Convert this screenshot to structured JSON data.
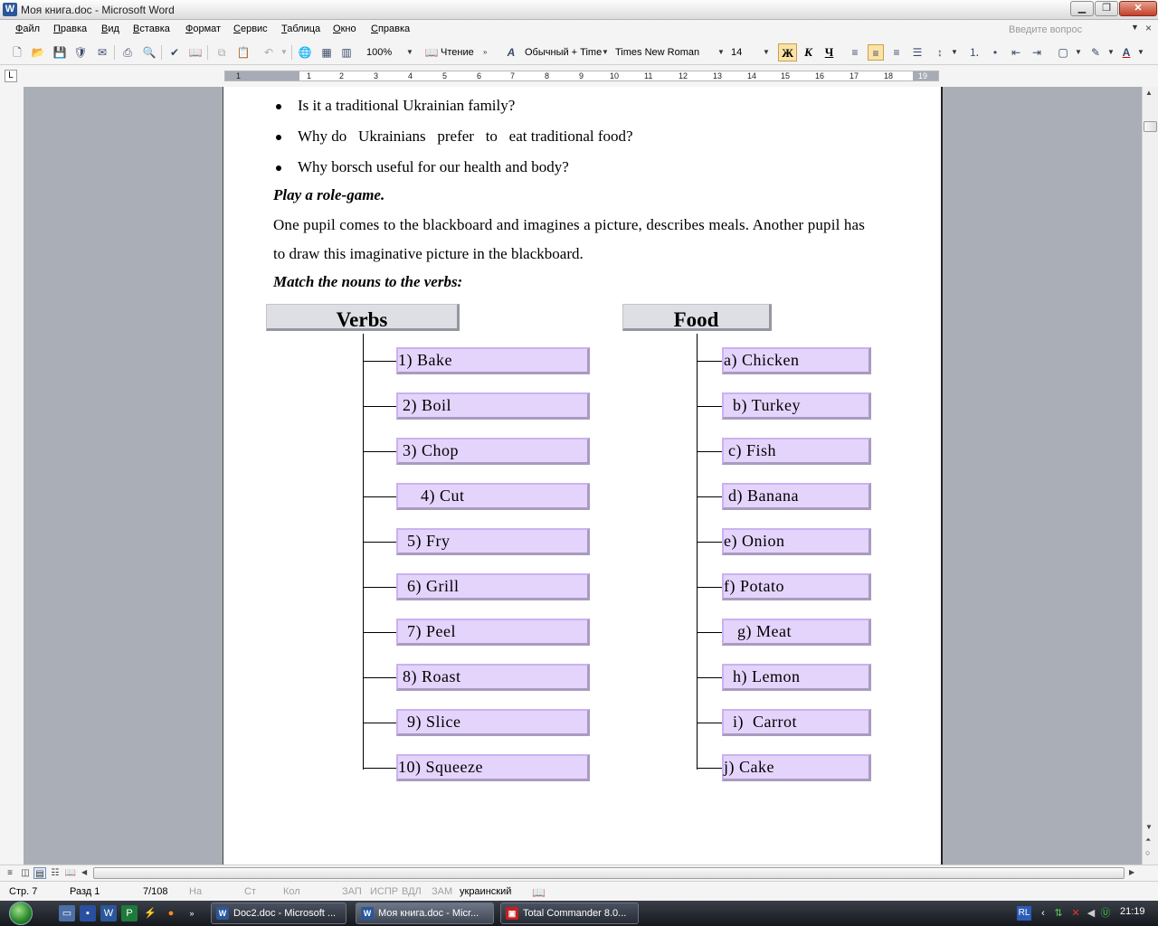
{
  "window": {
    "title": "Моя книга.doc - Microsoft Word"
  },
  "menu": {
    "items": [
      "Файл",
      "Правка",
      "Вид",
      "Вставка",
      "Формат",
      "Сервис",
      "Таблица",
      "Окно",
      "Справка"
    ],
    "question_placeholder": "Введите вопрос"
  },
  "toolbar": {
    "zoom": "100%",
    "reading": "Чтение",
    "style": "Обычный + Time",
    "font": "Times New Roman",
    "size": "14",
    "bold": "Ж",
    "italic": "К",
    "underline": "Ч"
  },
  "ruler": {
    "numbers": [
      "1",
      "1",
      "2",
      "3",
      "4",
      "5",
      "6",
      "7",
      "8",
      "9",
      "10",
      "11",
      "12",
      "13",
      "14",
      "15",
      "16",
      "17",
      "18",
      "19"
    ]
  },
  "document": {
    "bullets": [
      "Is it a traditional Ukrainian family?",
      "Why do   Ukrainians   prefer   to   eat traditional food?",
      "Why borsch useful for our health and body?"
    ],
    "heading_role_game": "Play a role-game.",
    "paragraph_line1": "One pupil comes to the blackboard and imagines a picture, describes meals. Another pupil has",
    "paragraph_line2": "to draw this imaginative picture in the blackboard.",
    "heading_match": "Match the nouns to the verbs:",
    "verbs_header": "Verbs",
    "food_header": "Food",
    "verbs": [
      "1) Bake",
      " 2) Boil",
      " 3) Chop",
      "     4) Cut",
      "  5) Fry",
      "  6) Grill",
      "  7) Peel",
      " 8) Roast",
      "  9) Slice",
      "10) Squeeze"
    ],
    "foods": [
      "a) Chicken",
      "  b) Turkey",
      " c) Fish",
      " d) Banana",
      "e) Onion",
      "f) Potato",
      "   g) Meat",
      "  h) Lemon",
      "  i)  Carrot",
      "j) Cake"
    ]
  },
  "status": {
    "page": "Стр. 7",
    "section": "Разд 1",
    "pages": "7/108",
    "at": "На",
    "line": "Ст",
    "col": "Кол",
    "rec": "ЗАП",
    "trk": "ИСПР",
    "ext": "ВДЛ",
    "ovr": "ЗАМ",
    "language": "украинский"
  },
  "taskbar": {
    "tasks": [
      "Doc2.doc - Microsoft ...",
      "Моя книга.doc - Micr...",
      "Total Commander 8.0..."
    ],
    "lang": "RL",
    "time": "21:19"
  }
}
